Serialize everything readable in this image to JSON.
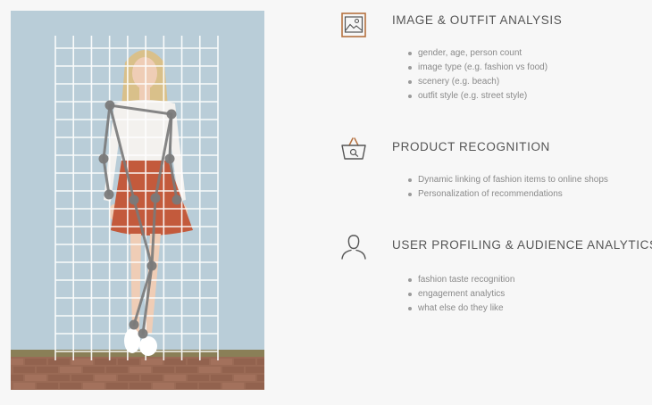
{
  "colors": {
    "background": "#f7f7f7",
    "wall": "#b9cdd8",
    "ground": "#9a6a55",
    "grid": "#ffffff",
    "skeleton": "#7a7a7a",
    "skirt": "#c35a3c",
    "heading_text": "#555555",
    "bullet_text": "#8a8a8a",
    "icon_accent": "#b5713f"
  },
  "photo": {
    "icon": "pose-estimation-photo",
    "overlay": "grid-and-pose-skeleton"
  },
  "features": [
    {
      "icon": "image-icon",
      "title": "IMAGE & OUTFIT ANALYSIS",
      "items": [
        "gender, age, person count",
        "image type (e.g. fashion vs food)",
        "scenery (e.g. beach)",
        "outfit style (e.g. street style)"
      ]
    },
    {
      "icon": "shopping-basket-search-icon",
      "title": "PRODUCT RECOGNITION",
      "items": [
        "Dynamic linking of fashion items to online shops",
        "Personalization of recommendations"
      ]
    },
    {
      "icon": "user-profile-icon",
      "title": "USER PROFILING & AUDIENCE ANALYTICS",
      "items": [
        "fashion taste recognition",
        "engagement analytics",
        "what else do they like"
      ]
    }
  ]
}
